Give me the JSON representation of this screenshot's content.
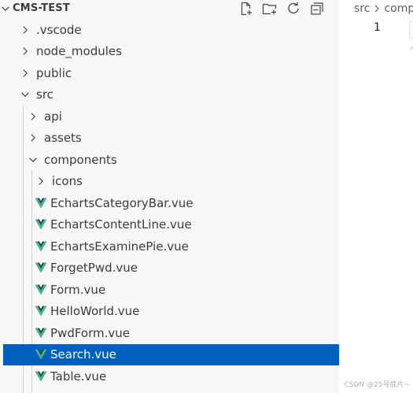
{
  "explorer": {
    "title": "CMS-TEST",
    "actions": [
      {
        "name": "new-file-icon"
      },
      {
        "name": "new-folder-icon"
      },
      {
        "name": "refresh-icon"
      },
      {
        "name": "collapse-all-icon"
      }
    ],
    "items": [
      {
        "label": ".vscode",
        "kind": "folder",
        "expanded": false,
        "depth": 1
      },
      {
        "label": "node_modules",
        "kind": "folder",
        "expanded": false,
        "depth": 1
      },
      {
        "label": "public",
        "kind": "folder",
        "expanded": false,
        "depth": 1
      },
      {
        "label": "src",
        "kind": "folder",
        "expanded": true,
        "depth": 1
      },
      {
        "label": "api",
        "kind": "folder",
        "expanded": false,
        "depth": 2
      },
      {
        "label": "assets",
        "kind": "folder",
        "expanded": false,
        "depth": 2
      },
      {
        "label": "components",
        "kind": "folder",
        "expanded": true,
        "depth": 2
      },
      {
        "label": "icons",
        "kind": "folder",
        "expanded": false,
        "depth": 3
      },
      {
        "label": "EchartsCategoryBar.vue",
        "kind": "vue",
        "depth": 3
      },
      {
        "label": "EchartsContentLine.vue",
        "kind": "vue",
        "depth": 3
      },
      {
        "label": "EchartsExaminePie.vue",
        "kind": "vue",
        "depth": 3
      },
      {
        "label": "ForgetPwd.vue",
        "kind": "vue",
        "depth": 3
      },
      {
        "label": "Form.vue",
        "kind": "vue",
        "depth": 3
      },
      {
        "label": "HelloWorld.vue",
        "kind": "vue",
        "depth": 3
      },
      {
        "label": "PwdForm.vue",
        "kind": "vue",
        "depth": 3
      },
      {
        "label": "Search.vue",
        "kind": "vue",
        "depth": 3,
        "selected": true
      },
      {
        "label": "Table.vue",
        "kind": "vue",
        "depth": 3
      }
    ]
  },
  "editor": {
    "breadcrumb": [
      "src",
      "comp"
    ],
    "line_number": "1"
  },
  "watermark": "CSDN @25号底片~",
  "colors": {
    "selection": "#0060c0",
    "vue_green": "#41b883",
    "vue_dark": "#34495e"
  }
}
